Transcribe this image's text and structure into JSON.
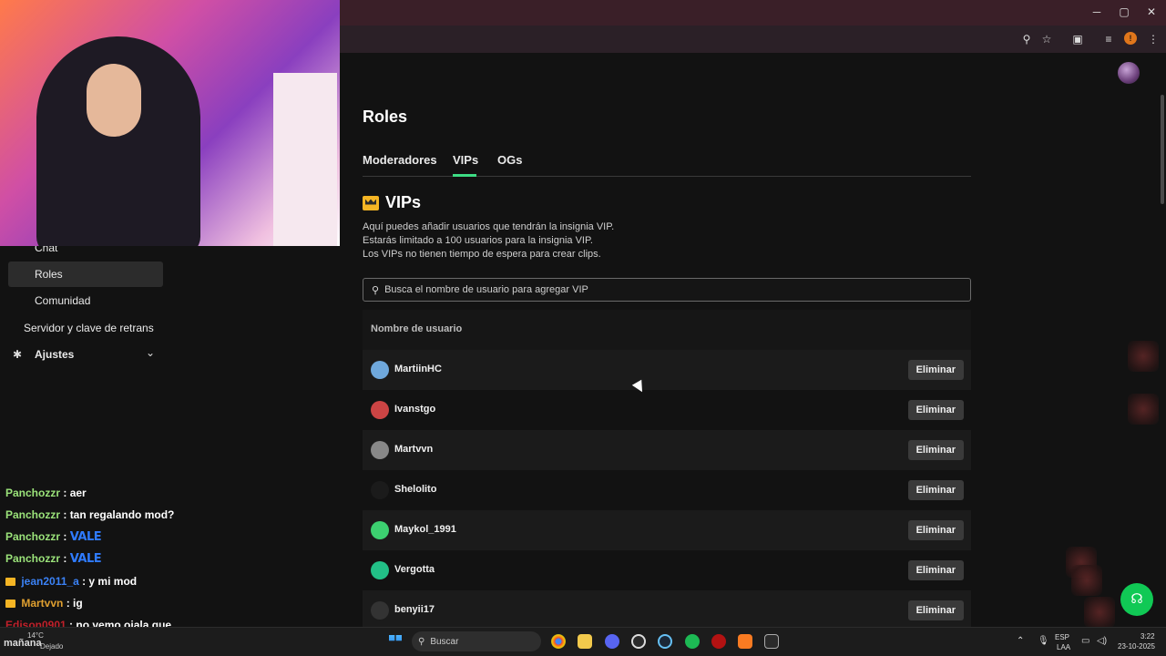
{
  "window": {
    "controls": {
      "minimize": "─",
      "maximize": "▢",
      "close": "✕"
    },
    "toolbar_icons": [
      "zoom-icon",
      "star-icon",
      "extensions-icon",
      "media-icon",
      "profile-icon",
      "menu-icon"
    ],
    "profile_initial": "!"
  },
  "left_panel": {
    "menu": {
      "chat": "Chat",
      "roles": "Roles",
      "comunidad": "Comunidad",
      "servidor": "Servidor y clave de retrans",
      "ajustes": "Ajustes"
    },
    "chat_messages": [
      {
        "user": "Panchozzr",
        "user_color": "#9be37a",
        "text": ": aer"
      },
      {
        "user": "Panchozzr",
        "user_color": "#9be37a",
        "text": ": tan regalando mod?"
      },
      {
        "user": "Panchozzr",
        "user_color": "#9be37a",
        "text": ":",
        "emote": "VALE"
      },
      {
        "user": "Panchozzr",
        "user_color": "#9be37a",
        "text": ":",
        "emote": "VALE"
      },
      {
        "user": "jean2011_a",
        "user_color": "#3b82f6",
        "text": ": y mi mod",
        "badge_color": "#f5b524"
      },
      {
        "user": "Martvvn",
        "user_color": "#e0a030",
        "text": ": ig",
        "badge_color": "#f5b524"
      },
      {
        "user": "Edison0901",
        "user_color": "#c0202a",
        "text": ": no vemo ojala que"
      }
    ]
  },
  "page": {
    "title": "Roles",
    "tabs": [
      {
        "label": "Moderadores",
        "active": false
      },
      {
        "label": "VIPs",
        "active": true
      },
      {
        "label": "OGs",
        "active": false
      }
    ],
    "section_title": "VIPs",
    "description": [
      "Aquí puedes añadir usuarios que tendrán la insignia VIP.",
      "Estarás limitado a 100 usuarios para la insignia VIP.",
      "Los VIPs no tienen tiempo de espera para crear clips."
    ],
    "search_placeholder": "Busca el nombre de usuario para agregar VIP",
    "column_header": "Nombre de usuario",
    "delete_label": "Eliminar",
    "users": [
      {
        "name": "MartiinHC",
        "avatar_color": "#6fa8dc"
      },
      {
        "name": "Ivanstgo",
        "avatar_color": "#c44"
      },
      {
        "name": "Martvvn",
        "avatar_color": "#888"
      },
      {
        "name": "Shelolito",
        "avatar_color": "#1b1b1b"
      },
      {
        "name": "Maykol_1991",
        "avatar_color": "#3cd070"
      },
      {
        "name": "Vergotta",
        "avatar_color": "#22c087"
      },
      {
        "name": "benyii17",
        "avatar_color": "#333"
      }
    ]
  },
  "taskbar": {
    "weather_temp": "14°C",
    "weather_text": "mañana",
    "weather_sub": "Dejado",
    "search_label": "Buscar",
    "lang_top": "ESP",
    "lang_bottom": "LAA",
    "time": "3:22",
    "date": "23-10-2025",
    "apps": [
      "chrome-icon",
      "folder-icon",
      "discord-icon",
      "obs-icon",
      "steam-icon",
      "spotify-icon",
      "record-icon",
      "editor-icon",
      "epic-games-icon"
    ]
  },
  "colors": {
    "accent_green": "#3ddc84",
    "crown_gold": "#f5b524",
    "support_green": "#10c955"
  }
}
